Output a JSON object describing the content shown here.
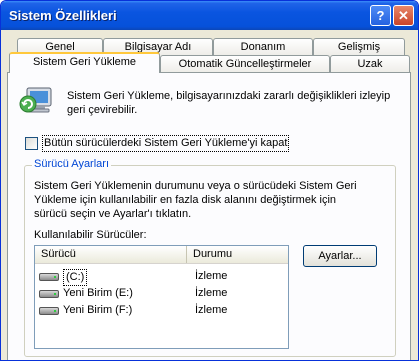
{
  "window": {
    "title": "Sistem Özellikleri",
    "help_label": "?",
    "close_label": "✕"
  },
  "tabs_row1": [
    {
      "label": "Genel"
    },
    {
      "label": "Bilgisayar Adı"
    },
    {
      "label": "Donanım"
    },
    {
      "label": "Gelişmiş"
    }
  ],
  "tabs_row2": [
    {
      "label": "Sistem Geri Yükleme",
      "active": true
    },
    {
      "label": "Otomatik Güncelleştirmeler"
    },
    {
      "label": "Uzak"
    }
  ],
  "restore": {
    "icon": "system-restore-icon",
    "description": "Sistem Geri Yükleme, bilgisayarınızdaki zararlı değişiklikleri izleyip geri çevirebilir.",
    "disable_all_label": "Bütün sürücülerdeki Sistem Geri Yükleme'yi kapat",
    "disable_all_checked": false
  },
  "drive_settings": {
    "title": "Sürücü Ayarları",
    "description": "Sistem Geri Yüklemenin durumunu veya o sürücüdeki Sistem Geri Yükleme için kullanılabilir en fazla disk alanını değiştirmek için sürücü seçin ve Ayarlar'ı tıklatın.",
    "list_label": "Kullanılabilir Sürücüler:",
    "columns": [
      "Sürücü",
      "Durumu"
    ],
    "drives": [
      {
        "name": "(C:)",
        "status": "İzleme",
        "selected": true
      },
      {
        "name": "Yeni Birim (E:)",
        "status": "İzleme"
      },
      {
        "name": "Yeni Birim (F:)",
        "status": "İzleme"
      }
    ],
    "settings_button": "Ayarlar..."
  },
  "colors": {
    "titlebar": "#0a55e0",
    "dialog_bg": "#ece9d8",
    "group_title": "#0046d5",
    "active_tab_accent": "#ffc83c"
  }
}
